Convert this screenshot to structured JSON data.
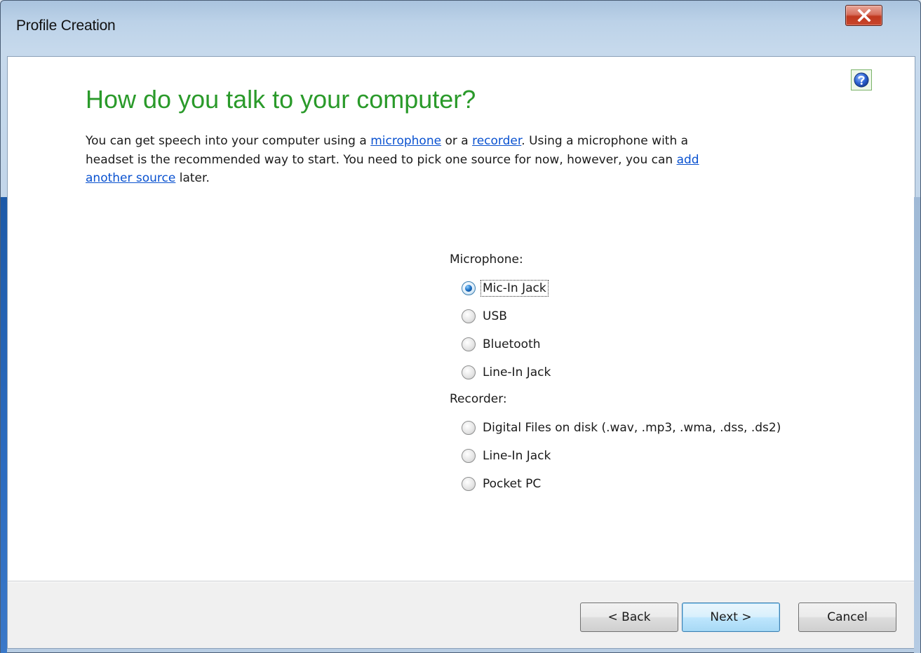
{
  "window": {
    "title": "Profile Creation"
  },
  "page": {
    "heading": "How do you talk to your computer?",
    "intro": {
      "part1": "You can get speech into your computer using a ",
      "link_microphone": "microphone",
      "part2": " or a ",
      "link_recorder": "recorder",
      "part3": ". Using a microphone with a headset is the recommended way to start. You need to pick one source for now, however, you can ",
      "link_add_source": "add another source",
      "part4": " later."
    }
  },
  "microphone_group": {
    "label": "Microphone:",
    "options": [
      {
        "label": "Mic-In Jack",
        "checked": true
      },
      {
        "label": "USB",
        "checked": false
      },
      {
        "label": "Bluetooth",
        "checked": false
      },
      {
        "label": "Line-In Jack",
        "checked": false
      }
    ]
  },
  "recorder_group": {
    "label": "Recorder:",
    "options": [
      {
        "label": "Digital Files on disk (.wav, .mp3, .wma, .dss, .ds2)",
        "checked": false
      },
      {
        "label": "Line-In Jack",
        "checked": false
      },
      {
        "label": "Pocket PC",
        "checked": false
      }
    ]
  },
  "footer": {
    "back_label": "< Back",
    "next_label": "Next >",
    "cancel_label": "Cancel"
  },
  "icons": {
    "close": "close-icon",
    "help": "help-icon"
  },
  "colors": {
    "heading": "#2a9a2a",
    "link": "#0a52d0",
    "close_button": "#c9462c"
  }
}
